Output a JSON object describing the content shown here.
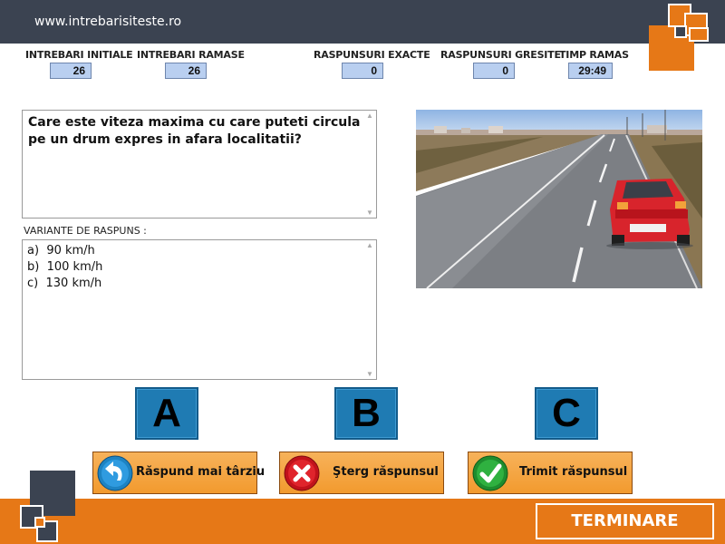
{
  "header": {
    "site_url": "www.intrebarisiteste.ro"
  },
  "stats": {
    "initial_questions": {
      "label": "INTREBARI INITIALE",
      "value": "26"
    },
    "remaining_questions": {
      "label": "INTREBARI RAMASE",
      "value": "26"
    },
    "correct_answers": {
      "label": "RASPUNSURI EXACTE",
      "value": "0"
    },
    "wrong_answers": {
      "label": "RASPUNSURI GRESITE",
      "value": "0"
    },
    "time_left": {
      "label": "TIMP RAMAS",
      "value": "29:49"
    }
  },
  "question": {
    "text": "Care este viteza maxima cu care puteti circula pe un drum expres in afara localitatii?"
  },
  "variants": {
    "label": "VARIANTE DE RASPUNS :",
    "items": [
      {
        "key": "a)",
        "text": "90 km/h"
      },
      {
        "key": "b)",
        "text": "100 km/h"
      },
      {
        "key": "c)",
        "text": "130 km/h"
      }
    ]
  },
  "answer_buttons": {
    "a": "A",
    "b": "B",
    "c": "C"
  },
  "actions": {
    "answer_later": "Răspund mai târziu",
    "clear_answer": "Şterg răspunsul",
    "submit_answer": "Trimit răspunsul"
  },
  "footer": {
    "finish_label": "TERMINARE"
  },
  "colors": {
    "header_bg": "#3b4351",
    "accent_orange": "#e67817",
    "letter_button_blue": "#1f7bb3",
    "stat_box_blue": "#b9cff0"
  },
  "icons": {
    "answer_later": "back-arrow-icon",
    "clear_answer": "red-x-icon",
    "submit_answer": "green-check-icon"
  }
}
